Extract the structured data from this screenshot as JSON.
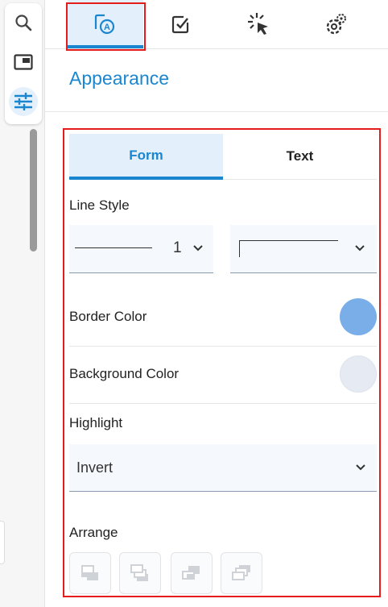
{
  "rail": {
    "icons": [
      "search-icon",
      "panel-layout-icon",
      "sliders-icon"
    ]
  },
  "top_tabs": [
    "appearance-tab-icon",
    "checkbox-icon",
    "cursor-click-icon",
    "gear-icon"
  ],
  "panel_title": "Appearance",
  "sub_tabs": {
    "form": "Form",
    "text": "Text"
  },
  "line_style": {
    "label": "Line Style",
    "width_value": "1"
  },
  "border_color": {
    "label": "Border Color",
    "color": "#7aaee8"
  },
  "background_color": {
    "label": "Background Color",
    "color": "#e6ebf3"
  },
  "highlight": {
    "label": "Highlight",
    "value": "Invert"
  },
  "arrange": {
    "label": "Arrange",
    "icons": [
      "bring-to-front-icon",
      "bring-forward-icon",
      "send-backward-icon",
      "send-to-back-icon"
    ]
  },
  "colors": {
    "accent": "#1a86d0",
    "highlight_box": "#e41c1c"
  }
}
